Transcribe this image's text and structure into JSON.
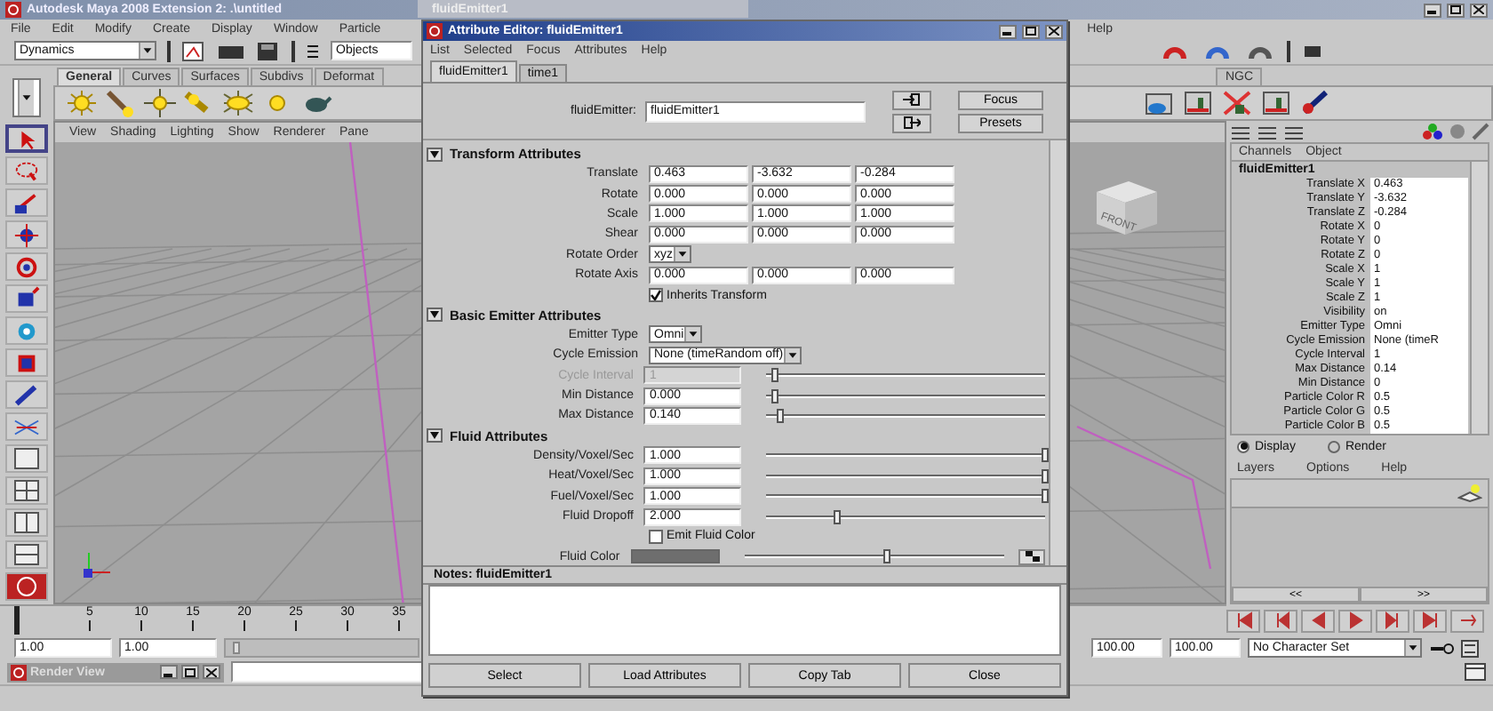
{
  "background_window": {
    "title": "fluidEmitter1"
  },
  "main_window": {
    "title": "Autodesk Maya 2008 Extension 2: .\\untitled",
    "menus": [
      "File",
      "Edit",
      "Modify",
      "Create",
      "Display",
      "Window",
      "Particle"
    ],
    "menus_right": [
      "Help"
    ],
    "toolbar": {
      "menu_set": "Dynamics",
      "selection_field": "Objects"
    },
    "shelf_tabs": [
      {
        "label": "General",
        "selected": true
      },
      {
        "label": "Curves",
        "selected": false
      },
      {
        "label": "Surfaces",
        "selected": false
      },
      {
        "label": "Subdivs",
        "selected": false
      },
      {
        "label": "Deformat",
        "selected": false
      }
    ],
    "shelf_tabs_right": [
      {
        "label": "NGC",
        "selected": false
      }
    ],
    "viewport_menus": [
      "View",
      "Shading",
      "Lighting",
      "Show",
      "Renderer",
      "Pane"
    ],
    "view_cube_label": "FRONT"
  },
  "channel_box": {
    "tabs": [
      "Channels",
      "Object"
    ],
    "node": "fluidEmitter1",
    "channels": [
      {
        "name": "Translate X",
        "value": "0.463"
      },
      {
        "name": "Translate Y",
        "value": "-3.632"
      },
      {
        "name": "Translate Z",
        "value": "-0.284"
      },
      {
        "name": "Rotate X",
        "value": "0"
      },
      {
        "name": "Rotate Y",
        "value": "0"
      },
      {
        "name": "Rotate Z",
        "value": "0"
      },
      {
        "name": "Scale X",
        "value": "1"
      },
      {
        "name": "Scale Y",
        "value": "1"
      },
      {
        "name": "Scale Z",
        "value": "1"
      },
      {
        "name": "Visibility",
        "value": "on"
      },
      {
        "name": "Emitter Type",
        "value": "Omni"
      },
      {
        "name": "Cycle Emission",
        "value": "None (timeR"
      },
      {
        "name": "Cycle Interval",
        "value": "1"
      },
      {
        "name": "Max Distance",
        "value": "0.14"
      },
      {
        "name": "Min Distance",
        "value": "0"
      },
      {
        "name": "Particle Color R",
        "value": "0.5"
      },
      {
        "name": "Particle Color G",
        "value": "0.5"
      },
      {
        "name": "Particle Color B",
        "value": "0.5"
      }
    ],
    "layer_modes": [
      {
        "label": "Display",
        "selected": true
      },
      {
        "label": "Render",
        "selected": false
      }
    ],
    "layer_menus": [
      "Layers",
      "Options",
      "Help"
    ],
    "scroll_buttons": [
      "<<",
      ">>"
    ]
  },
  "timeline": {
    "ticks": [
      "5",
      "10",
      "15",
      "20",
      "25",
      "30",
      "35"
    ],
    "level": 0
  },
  "range": {
    "level": 0.04,
    "start": "1.00",
    "current": "1.00",
    "end": "100.00",
    "end_total": "100.00",
    "character_set": "No Character Set"
  },
  "minimized_window": {
    "title": "Render View"
  },
  "attribute_editor": {
    "title": "Attribute Editor: fluidEmitter1",
    "menus": [
      "List",
      "Selected",
      "Focus",
      "Attributes",
      "Help"
    ],
    "tabs": [
      {
        "label": "fluidEmitter1",
        "selected": true
      },
      {
        "label": "time1",
        "selected": false
      }
    ],
    "node_label": "fluidEmitter:",
    "node_value": "fluidEmitter1",
    "buttons_side": [
      "Focus",
      "Presets"
    ],
    "sections": [
      {
        "title": "Transform Attributes",
        "expanded": true,
        "rows": [
          {
            "kind": "vector",
            "label": "Translate",
            "values": [
              "0.463",
              "-3.632",
              "-0.284"
            ]
          },
          {
            "kind": "vector",
            "label": "Rotate",
            "values": [
              "0.000",
              "0.000",
              "0.000"
            ]
          },
          {
            "kind": "vector",
            "label": "Scale",
            "values": [
              "1.000",
              "1.000",
              "1.000"
            ]
          },
          {
            "kind": "vector",
            "label": "Shear",
            "values": [
              "0.000",
              "0.000",
              "0.000"
            ]
          },
          {
            "kind": "dropdown",
            "label": "Rotate Order",
            "value": "xyz"
          },
          {
            "kind": "vector",
            "label": "Rotate Axis",
            "values": [
              "0.000",
              "0.000",
              "0.000"
            ]
          },
          {
            "kind": "checkbox",
            "label": "Inherits Transform",
            "checked": true
          }
        ]
      },
      {
        "title": "Basic Emitter Attributes",
        "expanded": true,
        "rows": [
          {
            "kind": "dropdown",
            "label": "Emitter Type",
            "value": "Omni"
          },
          {
            "kind": "dropdown",
            "label": "Cycle Emission",
            "value": "None (timeRandom off)"
          },
          {
            "kind": "slider",
            "label": "Cycle Interval",
            "value": "1",
            "level": 0.03,
            "disabled": true
          },
          {
            "kind": "slider",
            "label": "Min Distance",
            "value": "0.000",
            "level": 0.03,
            "disabled": false
          },
          {
            "kind": "slider",
            "label": "Max Distance",
            "value": "0.140",
            "level": 0.05,
            "disabled": false
          }
        ]
      },
      {
        "title": "Fluid Attributes",
        "expanded": true,
        "rows": [
          {
            "kind": "slider",
            "label": "Density/Voxel/Sec",
            "value": "1.000",
            "level": 1,
            "disabled": false
          },
          {
            "kind": "slider",
            "label": "Heat/Voxel/Sec",
            "value": "1.000",
            "level": 1,
            "disabled": false
          },
          {
            "kind": "slider",
            "label": "Fuel/Voxel/Sec",
            "value": "1.000",
            "level": 1,
            "disabled": false
          },
          {
            "kind": "slider",
            "label": "Fluid Dropoff",
            "value": "2.000",
            "level": 0.25,
            "disabled": false
          },
          {
            "kind": "checkbox",
            "label": "Emit Fluid Color",
            "checked": false
          },
          {
            "kind": "color",
            "label": "Fluid Color",
            "level": 0.55
          }
        ]
      }
    ],
    "notes_title": "Notes: fluidEmitter1",
    "buttons": [
      "Select",
      "Load Attributes",
      "Copy Tab",
      "Close"
    ]
  }
}
